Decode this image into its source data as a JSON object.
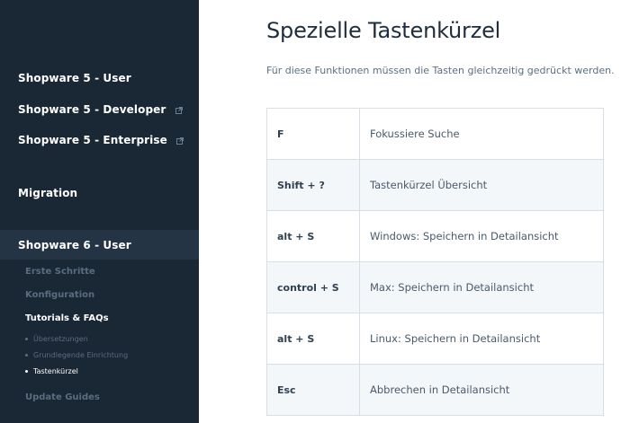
{
  "sidebar": {
    "top_items": [
      {
        "label": "Shopware 5 - User",
        "external": false
      },
      {
        "label": "Shopware 5 - Developer",
        "external": true
      },
      {
        "label": "Shopware 5 - Enterprise",
        "external": true
      },
      {
        "label": "Migration",
        "external": false
      },
      {
        "label": "Shopware 6 - User",
        "external": false
      }
    ],
    "sub_items": [
      {
        "label": "Erste Schritte"
      },
      {
        "label": "Konfiguration"
      },
      {
        "label": "Tutorials & FAQs"
      }
    ],
    "bullets": [
      {
        "label": "Übersetzungen"
      },
      {
        "label": "Grundlegende Einrichtung"
      },
      {
        "label": "Tastenkürzel"
      }
    ],
    "update_guides": "Update Guides"
  },
  "main": {
    "title": "Spezielle Tastenkürzel",
    "intro": "Für diese Funktionen müssen die Tasten gleichzeitig gedrückt werden.",
    "rows": [
      {
        "key": "F",
        "value": "Fokussiere Suche"
      },
      {
        "key": "Shift + ?",
        "value": "Tastenkürzel Übersicht"
      },
      {
        "key": "alt + S",
        "value": "Windows: Speichern in Detailansicht"
      },
      {
        "key": "control + S",
        "value": "Max: Speichern in Detailansicht"
      },
      {
        "key": "alt + S",
        "value": "Linux: Speichern in Detailansicht"
      },
      {
        "key": "Esc",
        "value": "Abbrechen in Detailansicht"
      }
    ]
  },
  "colors": {
    "sidebar_bg": "#1a2735",
    "active_band": "#243444",
    "muted_text": "#5a6d80",
    "table_border": "#d7dee5",
    "row_alt": "#f4f7fa"
  }
}
